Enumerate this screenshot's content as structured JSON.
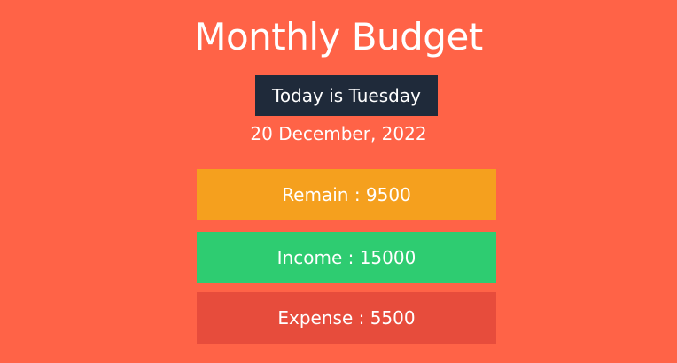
{
  "app": {
    "title": "Monthly Budget"
  },
  "date_info": {
    "day_label": "Today is Tuesday",
    "date": "20 December, 2022"
  },
  "stats": {
    "remain_label": "Remain : 9500",
    "income_label": "Income : 15000",
    "expense_label": "Expense : 5500"
  },
  "colors": {
    "background": "#FF6347",
    "day_badge": "#1F2A3A",
    "remain": "#F5A01E",
    "income": "#2ECC71",
    "expense": "#E74C3C"
  }
}
